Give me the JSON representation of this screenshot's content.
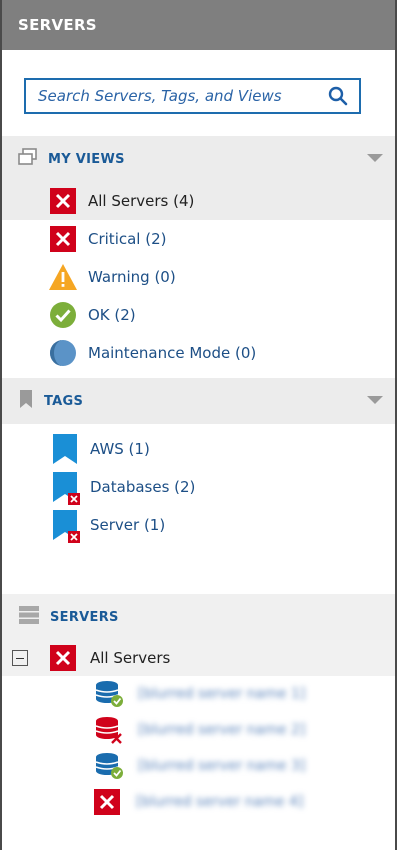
{
  "panel": {
    "title": "SERVERS"
  },
  "search": {
    "placeholder": "Search Servers, Tags, and Views"
  },
  "my_views": {
    "title": "MY VIEWS",
    "items": [
      {
        "label": "All Servers (4)",
        "icon": "critical-icon"
      },
      {
        "label": "Critical (2)",
        "icon": "critical-icon"
      },
      {
        "label": "Warning (0)",
        "icon": "warning-icon"
      },
      {
        "label": "OK (2)",
        "icon": "ok-icon"
      },
      {
        "label": "Maintenance Mode (0)",
        "icon": "maintenance-icon"
      }
    ]
  },
  "tags": {
    "title": "TAGS",
    "items": [
      {
        "label": "AWS (1)",
        "icon": "tag-icon"
      },
      {
        "label": "Databases (2)",
        "icon": "tag-critical-icon"
      },
      {
        "label": "Server (1)",
        "icon": "tag-critical-icon"
      }
    ]
  },
  "servers": {
    "title": "SERVERS",
    "root_label": "All Servers",
    "children": [
      {
        "label": "[blurred server name 1]",
        "icon": "db-ok-icon"
      },
      {
        "label": "[blurred server name 2]",
        "icon": "db-critical-icon"
      },
      {
        "label": "[blurred server name 3]",
        "icon": "db-ok-icon"
      },
      {
        "label": "[blurred server name 4]",
        "icon": "critical-icon"
      }
    ]
  },
  "colors": {
    "accent": "#1d6cae",
    "critical": "#d0021b",
    "warning": "#f5a623",
    "ok": "#7cae3a"
  }
}
